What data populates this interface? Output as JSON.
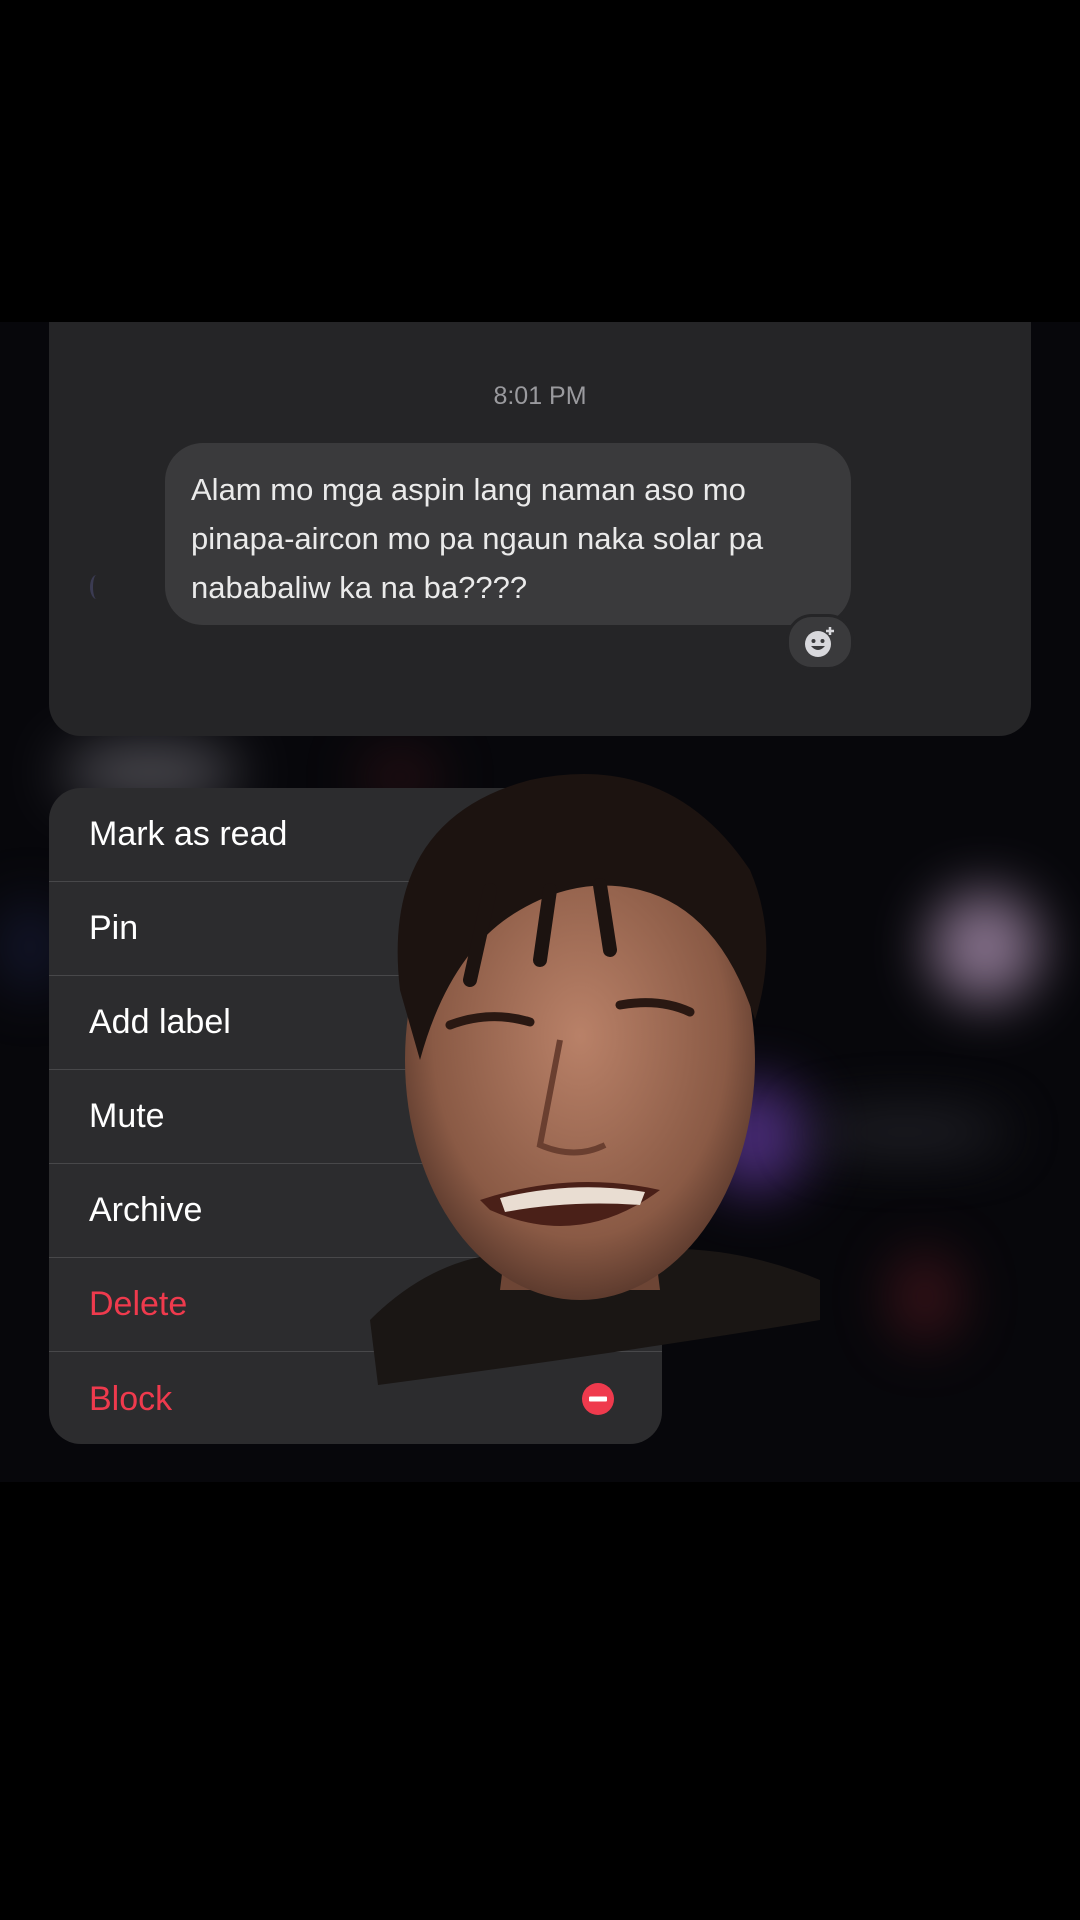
{
  "message_preview": {
    "timestamp": "8:01 PM",
    "message_text": "Alam mo mga aspin lang naman aso mo pinapa-aircon mo pa ngaun naka solar pa nababaliw ka na ba????",
    "reaction_icon": "add-reaction-icon"
  },
  "context_menu": {
    "items": [
      {
        "label": "Mark as read",
        "destructive": false
      },
      {
        "label": "Pin",
        "destructive": false
      },
      {
        "label": "Add label",
        "destructive": false
      },
      {
        "label": "Mute",
        "destructive": false
      },
      {
        "label": "Archive",
        "destructive": false
      },
      {
        "label": "Delete",
        "destructive": true
      },
      {
        "label": "Block",
        "destructive": true,
        "icon": "minus-circle-icon"
      }
    ]
  },
  "colors": {
    "background": "#000000",
    "card": "#252527",
    "bubble": "#3a3a3c",
    "menu": "#2c2c2e",
    "destructive": "#ef3a4d"
  }
}
